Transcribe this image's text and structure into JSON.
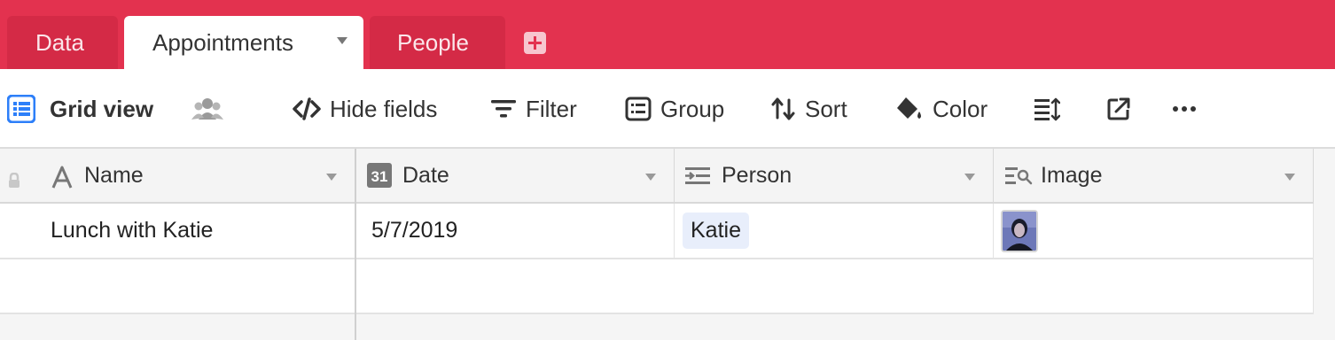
{
  "tabs": [
    {
      "label": "Data",
      "active": false
    },
    {
      "label": "Appointments",
      "active": true
    },
    {
      "label": "People",
      "active": false
    }
  ],
  "toolbar": {
    "view_name": "Grid view",
    "hide_fields": "Hide fields",
    "filter": "Filter",
    "group": "Group",
    "sort": "Sort",
    "color": "Color"
  },
  "columns": [
    {
      "label": "Name",
      "icon": "text-field-icon"
    },
    {
      "label": "Date",
      "icon": "calendar-icon",
      "icon_text": "31"
    },
    {
      "label": "Person",
      "icon": "link-record-icon"
    },
    {
      "label": "Image",
      "icon": "lookup-icon"
    }
  ],
  "rows": [
    {
      "name": "Lunch with Katie",
      "date": "5/7/2019",
      "person": "Katie"
    }
  ],
  "colors": {
    "brand": "#e3324f",
    "accent_blue": "#2d7ff9",
    "pill": "#e8eefb"
  }
}
